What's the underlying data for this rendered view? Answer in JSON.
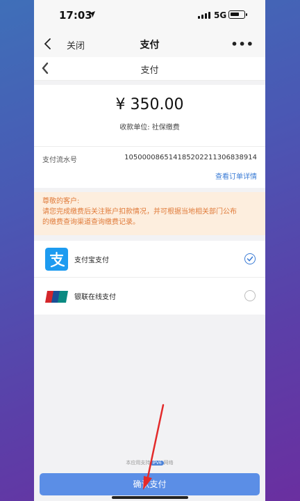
{
  "status_bar": {
    "time": "17:03",
    "network": "5G"
  },
  "nav": {
    "close_label": "关闭",
    "title": "支付"
  },
  "page": {
    "title": "支付"
  },
  "payment": {
    "amount": "¥ 350.00",
    "payee": "收款单位: 社保缴费",
    "serial_label": "支付流水号",
    "serial_number": "105000086514185202211306838914",
    "order_link": "查看订单详情"
  },
  "notice": {
    "greeting": "尊敬的客户:",
    "line1": "请您完成缴费后关注账户扣款情况，并可根据当地相关部门公布",
    "line2": "的缴费查询渠道查询缴费记录。"
  },
  "methods": [
    {
      "label": "支付宝支付",
      "selected": true,
      "logo_color": "#1d9bf0"
    },
    {
      "label": "银联在线支付",
      "selected": false,
      "logo_color": "#d4262b"
    }
  ],
  "footer": {
    "note_pre": "本应用支持",
    "ipv6": "IPV6",
    "note_post": "网络"
  },
  "confirm_button": "确认支付",
  "colors": {
    "accent": "#3a7bd5",
    "button": "#5b8ee6",
    "notice_bg": "#fdeede",
    "notice_text": "#e07b3a"
  }
}
